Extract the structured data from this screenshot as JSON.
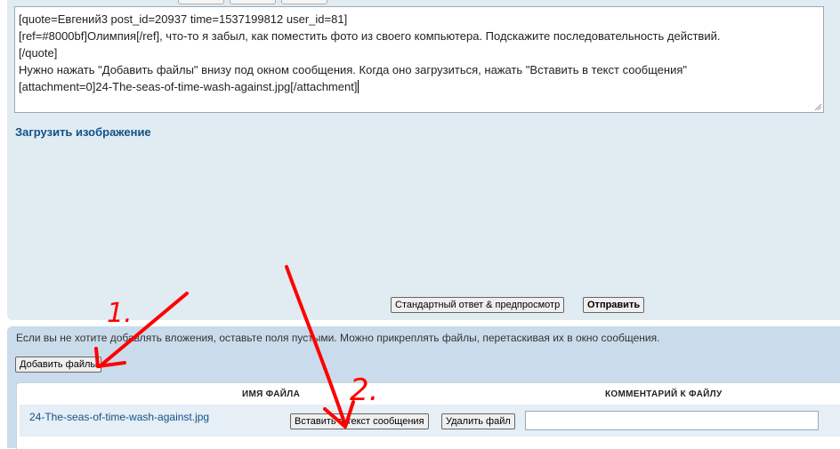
{
  "editor": {
    "lines": [
      "[quote=Евгений3 post_id=20937 time=1537199812 user_id=81]",
      "[ref=#8000bf]Олимпия[/ref], что-то я забыл, как поместить фото из своего компьютера. Подскажите последовательность действий.",
      "[/quote]",
      "Нужно нажать \"Добавить файлы\" внизу под окном сообщения. Когда оно загрузиться, нажать \"Вставить в текст сообщения\"",
      "",
      "[attachment=0]24-The-seas-of-time-wash-against.jpg[/attachment]"
    ]
  },
  "upload_image_link": "Загрузить изображение",
  "actions": {
    "preview_label": "Стандартный ответ & предпросмотр",
    "submit_label": "Отправить"
  },
  "attachments": {
    "hint": "Если вы не хотите добавлять вложения, оставьте поля пустыми. Можно прикреплять файлы, перетаскивая их в окно сообщения.",
    "add_files_label": "Добавить файлы",
    "columns": {
      "filename": "ИМЯ ФАЙЛА",
      "comment": "КОММЕНТАРИЙ К ФАЙЛУ"
    },
    "rows": [
      {
        "filename": "24-The-seas-of-time-wash-against.jpg",
        "insert_label": "Вставить в текст сообщения",
        "delete_label": "Удалить файл",
        "comment_value": ""
      }
    ]
  },
  "annotations": {
    "label_1": "1.",
    "label_2": "2.",
    "color": "#ff0000"
  },
  "colors": {
    "panel_top": "#e1ebf2",
    "panel_bottom": "#cadceb",
    "link": "#105289"
  }
}
